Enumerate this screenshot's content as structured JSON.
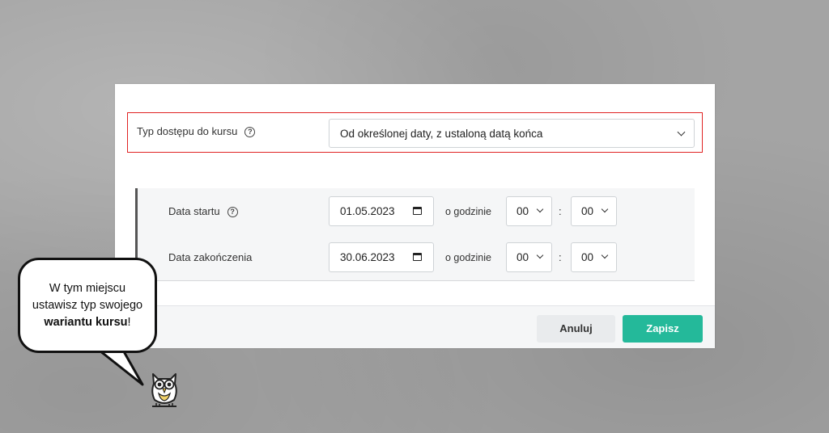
{
  "form": {
    "access_type": {
      "label": "Typ dostępu do kursu",
      "help_glyph": "?",
      "selected": "Od określonej daty, z ustaloną datą końca"
    },
    "start_date": {
      "label": "Data startu",
      "help_glyph": "?",
      "date": "01.05.2023",
      "at_label": "o godzinie",
      "hour": "00",
      "minute": "00"
    },
    "end_date": {
      "label": "Data zakończenia",
      "date": "30.06.2023",
      "at_label": "o godzinie",
      "hour": "00",
      "minute": "00"
    },
    "time_separator": ":",
    "buttons": {
      "cancel": "Anuluj",
      "save": "Zapisz"
    }
  },
  "bubble": {
    "line1": "W tym miejscu",
    "line2": "ustawisz typ swojego",
    "bold": "wariantu kursu",
    "suffix": "!"
  },
  "colors": {
    "highlight_border": "#e02424",
    "save_button": "#24b99a",
    "cancel_button": "#e9ebed",
    "background": "#a4a4a4"
  }
}
